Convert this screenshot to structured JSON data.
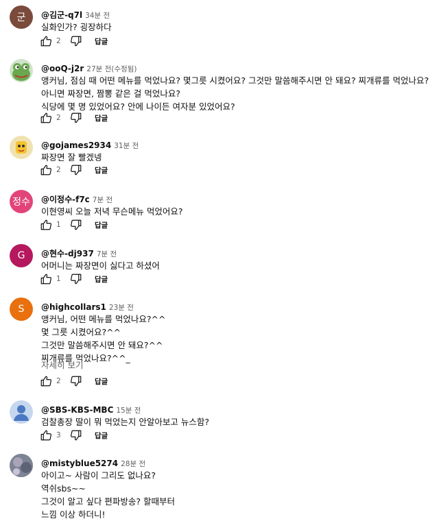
{
  "comments": [
    {
      "author": "@김군-q7l",
      "time": "34분 전",
      "lines": [
        "실화인가? 굉장하다"
      ],
      "likes": "2",
      "reply": "답글",
      "avatar": {
        "text": "군",
        "color": "#7a4a3a"
      }
    },
    {
      "author": "@ooQ-j2r",
      "time": "27분 전(수정됨)",
      "lines": [
        "앵커님, 점심 때 어떤 메뉴를 먹었나요? 몇그릇 시켰어요? 그것만 말씀해주시면 안 돼요? 찌개류를 먹었나요?",
        "아니면 짜장면, 짬뽕 같은 걸 먹었나요?",
        "식당에 몇 명 있었어요? 안에 나이든 여자분 있었어요?"
      ],
      "likes": "2",
      "reply": "답글",
      "avatar": {
        "text": "",
        "color": "#cfe3c8",
        "icon": "frog-avatar-icon"
      }
    },
    {
      "author": "@gojames2934",
      "time": "31분 전",
      "lines": [
        "짜장면 잘 빨겠넹"
      ],
      "likes": "2",
      "reply": "답글",
      "avatar": {
        "text": "",
        "color": "#f0e2b0",
        "icon": "cartoon-avatar-icon"
      }
    },
    {
      "author": "@이정수-f7c",
      "time": "7분 전",
      "lines": [
        "이현영씨 오늘 저녁 무슨메뉴 먹었어요?"
      ],
      "likes": "1",
      "reply": "답글",
      "avatar": {
        "text": "정수",
        "color": "#e2447a"
      }
    },
    {
      "author": "@현수-dj937",
      "time": "7분 전",
      "lines": [
        "어머니는 짜장면이 싫다고 하셨어"
      ],
      "likes": "1",
      "reply": "답글",
      "avatar": {
        "text": "G",
        "color": "#b5185e"
      }
    },
    {
      "author": "@highcollars1",
      "time": "23분 전",
      "lines": [
        "앵커님, 어떤 메뉴를 먹었나요?^^",
        "몇 그릇 시켰어요?^^",
        "그것만 말씀해주시면 안 돼요?^^",
        "찌개류를 먹었나요?^^_"
      ],
      "more": "자세히 보기",
      "likes": "2",
      "reply": "답글",
      "avatar": {
        "text": "S",
        "color": "#e8700e"
      }
    },
    {
      "author": "@SBS-KBS-MBC",
      "time": "15분 전",
      "lines": [
        "검찰총장 딸이 뭐 먹었는지 안알아보고 뉴스함?"
      ],
      "likes": "3",
      "reply": "답글",
      "avatar": {
        "text": "",
        "color": "#c5d7ee",
        "icon": "default-user-icon"
      }
    },
    {
      "author": "@mistyblue5274",
      "time": "28분 전",
      "lines": [
        "아이고~ 사람이 그리도 없나요?",
        "역쉬sbs~~",
        "그것이 알고 싶다 편파방송? 할때부터",
        "느낌 이상 하더니!"
      ],
      "avatar": {
        "text": "",
        "color": "#8a8f9a",
        "icon": "photo-avatar-icon"
      }
    }
  ]
}
